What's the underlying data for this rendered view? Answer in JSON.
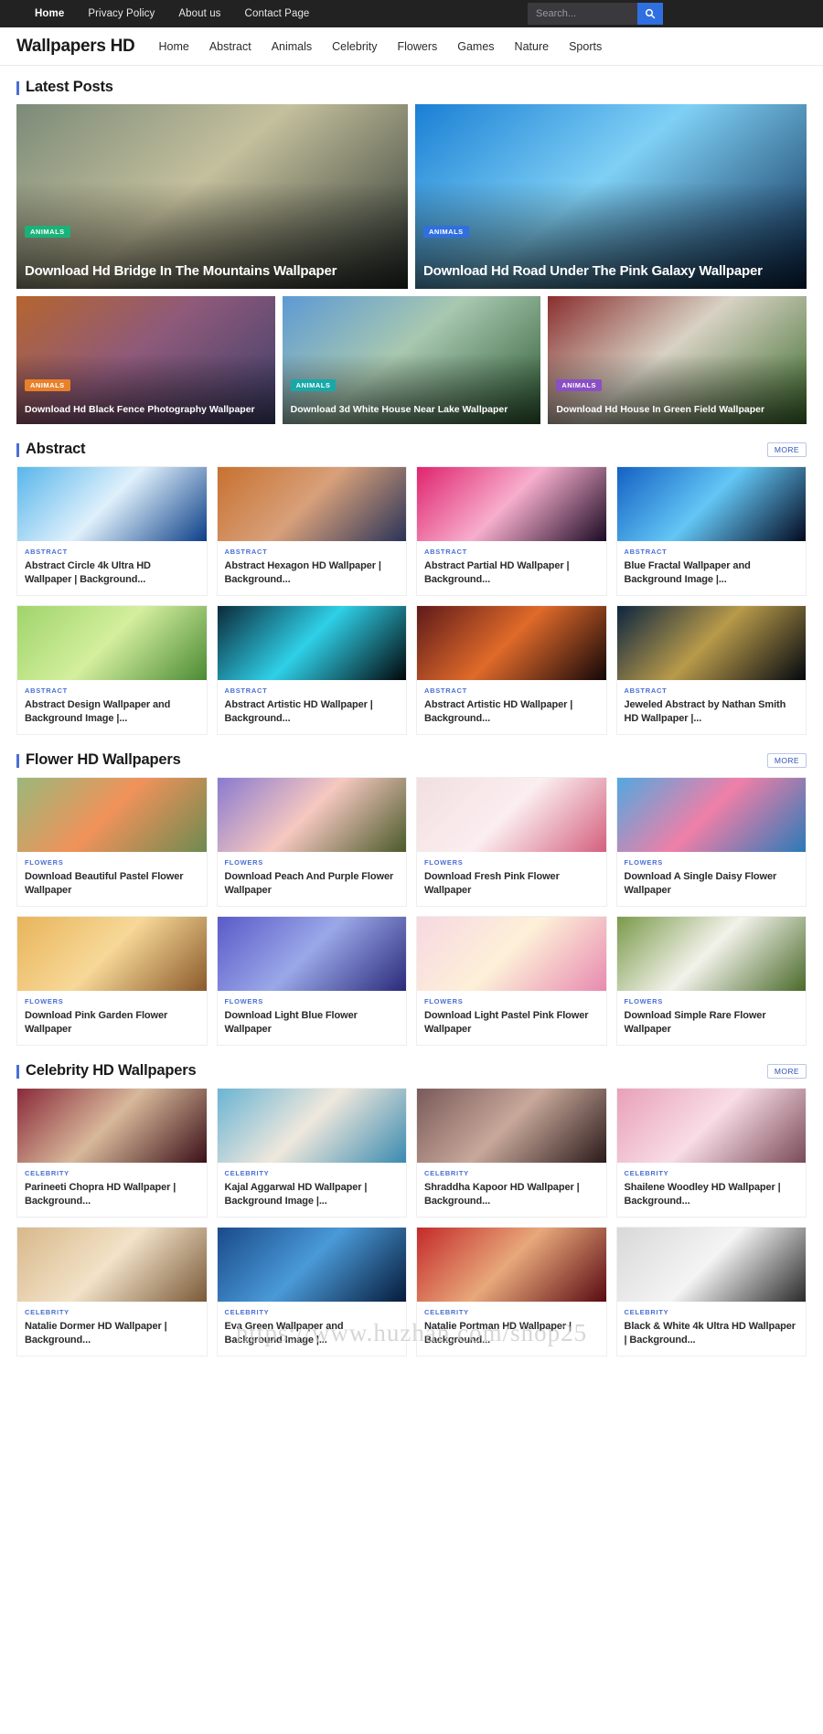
{
  "topbar": {
    "links": [
      "Home",
      "Privacy Policy",
      "About us",
      "Contact Page"
    ],
    "search_placeholder": "Search...",
    "search_value": "",
    "search_icon": "search-icon",
    "bg_color": "#222222",
    "search_button_color": "#2f6fe0"
  },
  "masthead": {
    "brand": "Wallpapers HD",
    "nav": [
      "Home",
      "Abstract",
      "Animals",
      "Celebrity",
      "Flowers",
      "Games",
      "Nature",
      "Sports"
    ]
  },
  "more_label": "MORE",
  "sections": [
    {
      "title": "Latest Posts",
      "has_more": false,
      "hero": [
        {
          "badge": "ANIMALS",
          "badge_color": "#19b37a",
          "title": "Download Hd Bridge In The Mountains Wallpaper",
          "img_a": "#7b8a78",
          "img_b": "#2d3630",
          "img_c": "#c4c09d"
        },
        {
          "badge": "ANIMALS",
          "badge_color": "#2f6fe0",
          "title": "Download Hd Road Under The Pink Galaxy Wallpaper",
          "img_a": "#1a7fd4",
          "img_b": "#0a2a52",
          "img_c": "#7fd0f5"
        }
      ],
      "small": [
        {
          "badge": "ANIMALS",
          "badge_color": "#e8812a",
          "title": "Download Hd Black Fence Photography Wallpaper",
          "img_a": "#b5652e",
          "img_b": "#3d3f6b",
          "img_c": "#8f5a7a"
        },
        {
          "badge": "ANIMALS",
          "badge_color": "#19a8a8",
          "title": "Download 3d White House Near Lake Wallpaper",
          "img_a": "#5d9ad4",
          "img_b": "#2c5a32",
          "img_c": "#a8c8b0"
        },
        {
          "badge": "ANIMALS",
          "badge_color": "#8a4fc4",
          "title": "Download Hd House In Green Field Wallpaper",
          "img_a": "#8a2f2f",
          "img_b": "#3a6b2a",
          "img_c": "#d8d2c4"
        }
      ]
    },
    {
      "title": "Abstract",
      "has_more": true,
      "cards": [
        {
          "cat": "ABSTRACT",
          "name": "Abstract Circle 4k Ultra HD Wallpaper | Background...",
          "img_a": "#58b6ec",
          "img_b": "#0c3f88",
          "img_c": "#dff0fb"
        },
        {
          "cat": "ABSTRACT",
          "name": "Abstract Hexagon HD Wallpaper | Background...",
          "img_a": "#c8712f",
          "img_b": "#2a3358",
          "img_c": "#d8a07a"
        },
        {
          "cat": "ABSTRACT",
          "name": "Abstract Partial HD Wallpaper | Background...",
          "img_a": "#e0246e",
          "img_b": "#1b0a24",
          "img_c": "#f7aecd"
        },
        {
          "cat": "ABSTRACT",
          "name": "Blue Fractal Wallpaper and Background Image |...",
          "img_a": "#1461c4",
          "img_b": "#030a20",
          "img_c": "#63c6f5"
        },
        {
          "cat": "ABSTRACT",
          "name": "Abstract Design Wallpaper and Background Image |...",
          "img_a": "#9fd46a",
          "img_b": "#4b8a34",
          "img_c": "#d4ef9e"
        },
        {
          "cat": "ABSTRACT",
          "name": "Abstract Artistic HD Wallpaper | Background...",
          "img_a": "#0b2a3a",
          "img_b": "#020609",
          "img_c": "#2fd0e8"
        },
        {
          "cat": "ABSTRACT",
          "name": "Abstract Artistic HD Wallpaper | Background...",
          "img_a": "#5e1a1a",
          "img_b": "#130608",
          "img_c": "#e06a2a"
        },
        {
          "cat": "ABSTRACT",
          "name": "Jeweled Abstract by Nathan Smith HD Wallpaper |...",
          "img_a": "#0d2540",
          "img_b": "#03080f",
          "img_c": "#b89a4a"
        }
      ]
    },
    {
      "title": "Flower HD Wallpapers",
      "has_more": true,
      "cards": [
        {
          "cat": "FLOWERS",
          "name": "Download Beautiful Pastel Flower Wallpaper",
          "img_a": "#9ab87a",
          "img_b": "#6e8a50",
          "img_c": "#f0925a"
        },
        {
          "cat": "FLOWERS",
          "name": "Download Peach And Purple Flower Wallpaper",
          "img_a": "#8a7ad0",
          "img_b": "#4a5a2a",
          "img_c": "#f6c8c0"
        },
        {
          "cat": "FLOWERS",
          "name": "Download Fresh Pink Flower Wallpaper",
          "img_a": "#f2dfe0",
          "img_b": "#d4607e",
          "img_c": "#fbeef0"
        },
        {
          "cat": "FLOWERS",
          "name": "Download A Single Daisy Flower Wallpaper",
          "img_a": "#52a8e0",
          "img_b": "#2b7ab8",
          "img_c": "#ef7fa8"
        },
        {
          "cat": "FLOWERS",
          "name": "Download Pink Garden Flower Wallpaper",
          "img_a": "#e8b45a",
          "img_b": "#8a5a2a",
          "img_c": "#f7d898"
        },
        {
          "cat": "FLOWERS",
          "name": "Download Light Blue Flower Wallpaper",
          "img_a": "#5a5ac8",
          "img_b": "#2a2a7a",
          "img_c": "#9aa8e8"
        },
        {
          "cat": "FLOWERS",
          "name": "Download Light Pastel Pink Flower Wallpaper",
          "img_a": "#f7d8e2",
          "img_b": "#e88ab0",
          "img_c": "#fdf0d8"
        },
        {
          "cat": "FLOWERS",
          "name": "Download Simple Rare Flower Wallpaper",
          "img_a": "#7a9a4a",
          "img_b": "#4a6a2a",
          "img_c": "#f2f2ea"
        }
      ]
    },
    {
      "title": "Celebrity HD Wallpapers",
      "has_more": true,
      "cards": [
        {
          "cat": "CELEBRITY",
          "name": "Parineeti Chopra HD Wallpaper | Background...",
          "img_a": "#8a2a3a",
          "img_b": "#3a1018",
          "img_c": "#d8b89a"
        },
        {
          "cat": "CELEBRITY",
          "name": "Kajal Aggarwal HD Wallpaper | Background Image |...",
          "img_a": "#6ab4d4",
          "img_b": "#3a8ab0",
          "img_c": "#efe8dc"
        },
        {
          "cat": "CELEBRITY",
          "name": "Shraddha Kapoor HD Wallpaper | Background...",
          "img_a": "#7a5a5a",
          "img_b": "#2a1a1a",
          "img_c": "#c8a89a"
        },
        {
          "cat": "CELEBRITY",
          "name": "Shailene Woodley HD Wallpaper | Background...",
          "img_a": "#e8a0b8",
          "img_b": "#7a4a58",
          "img_c": "#f8dce6"
        },
        {
          "cat": "CELEBRITY",
          "name": "Natalie Dormer HD Wallpaper | Background...",
          "img_a": "#d8b88a",
          "img_b": "#7a5a38",
          "img_c": "#f2e2c8"
        },
        {
          "cat": "CELEBRITY",
          "name": "Eva Green Wallpaper and Background Image |...",
          "img_a": "#1a4a8a",
          "img_b": "#061a3a",
          "img_c": "#4a9ad8"
        },
        {
          "cat": "CELEBRITY",
          "name": "Natalie Portman HD Wallpaper | Background...",
          "img_a": "#c42a2a",
          "img_b": "#5a0a12",
          "img_c": "#e8a87a"
        },
        {
          "cat": "CELEBRITY",
          "name": "Black & White 4k Ultra HD Wallpaper | Background...",
          "img_a": "#d8d8d8",
          "img_b": "#2a2a2a",
          "img_c": "#f4f4f4"
        }
      ]
    }
  ],
  "watermark": "https://www.huzhan.com/shop25"
}
